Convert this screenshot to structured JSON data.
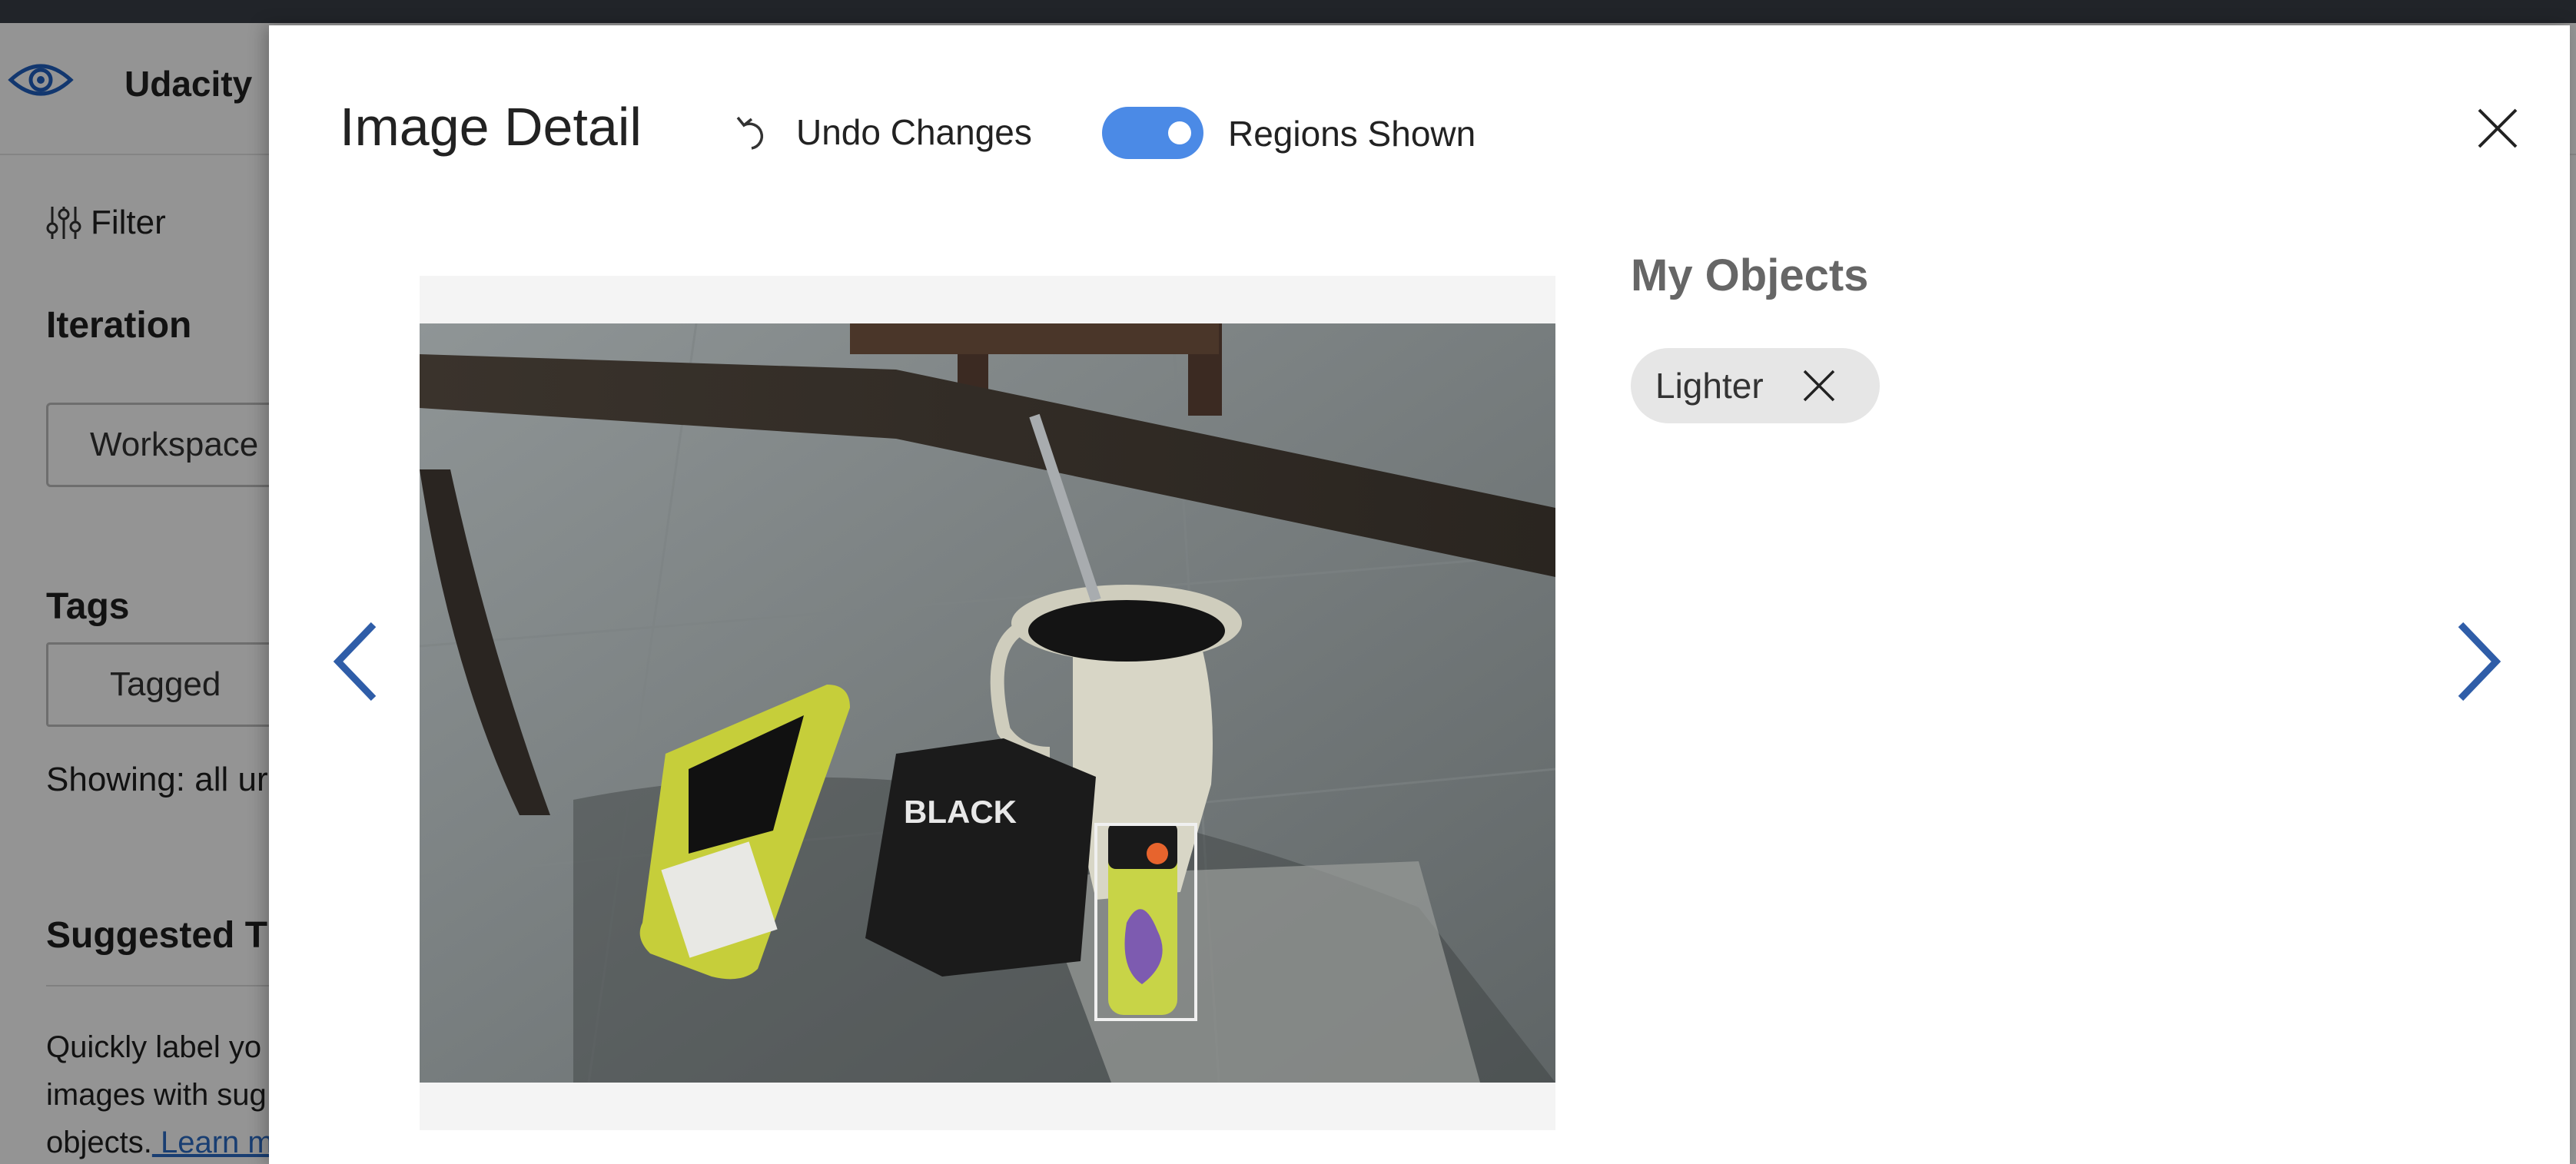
{
  "app": {
    "name": "Udacity",
    "filter_label": "Filter",
    "iteration_heading": "Iteration",
    "iteration_value": "Workspace",
    "tags_heading": "Tags",
    "tagged_button": "Tagged",
    "showing_text": "Showing: all ur",
    "suggested_heading": "Suggested T",
    "suggested_desc": "Quickly label yo images with sug objects.",
    "learn_more": " Learn m"
  },
  "modal": {
    "title": "Image Detail",
    "undo_label": "Undo Changes",
    "regions_label": "Regions Shown",
    "regions_on": true,
    "objects_heading": "My Objects",
    "objects": [
      {
        "label": "Lighter"
      }
    ]
  },
  "colors": {
    "accent": "#4b8ae6",
    "nav_arrow": "#2f5da8",
    "chip": "#e6e6e6",
    "topbar": "#3a3f47"
  },
  "icons": {
    "logo": "eye-gear-icon",
    "filter": "sliders-icon",
    "undo": "undo-icon",
    "close": "close-icon",
    "prev": "chevron-left-icon",
    "next": "chevron-right-icon",
    "chip_remove": "close-icon"
  }
}
